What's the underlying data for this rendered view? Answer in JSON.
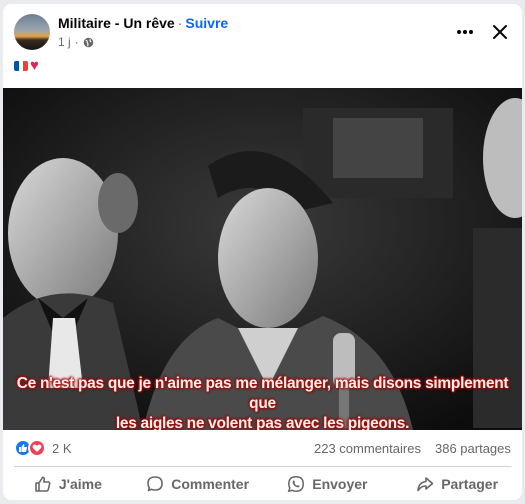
{
  "post": {
    "page_name": "Militaire - Un rêve",
    "separator": "·",
    "follow_label": "Suivre",
    "time": "1 j",
    "meta_separator": "·",
    "caption_emoji": "♥"
  },
  "image": {
    "subtitle_line1": "Ce n'est pas que je n'aime pas me mélanger, mais disons simplement que",
    "subtitle_line2": "les aigles ne volent pas avec les pigeons."
  },
  "stats": {
    "reaction_count": "2 K",
    "comments": "223 commentaires",
    "shares": "386 partages"
  },
  "actions": {
    "like": "J'aime",
    "comment": "Commenter",
    "send": "Envoyer",
    "share": "Partager"
  },
  "colors": {
    "follow": "#0866ff",
    "like_blue": "#1877f2",
    "love_red": "#f33e58",
    "flag_blue": "#0055a4",
    "flag_red": "#ef4135"
  },
  "icons": [
    "globe-icon",
    "more-icon",
    "close-icon",
    "like-reaction-icon",
    "love-reaction-icon",
    "thumbs-up-icon",
    "comment-icon",
    "whatsapp-icon",
    "share-icon"
  ]
}
